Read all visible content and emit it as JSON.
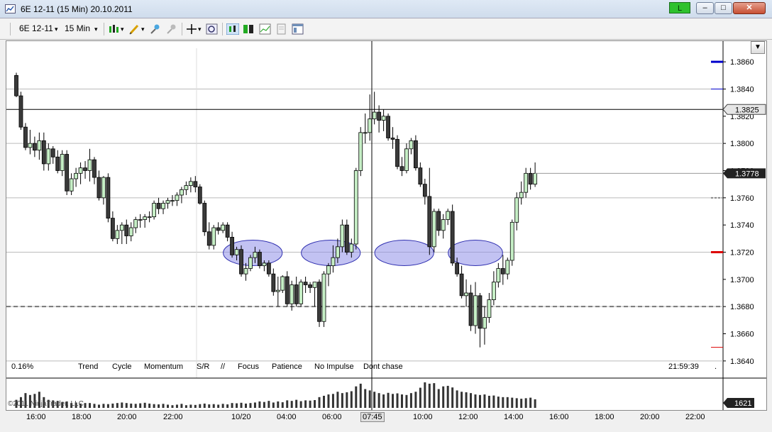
{
  "window": {
    "title": "6E 12-11 (15 Min)  20.10.2011",
    "connection_label": "L",
    "minimize": "–",
    "maximize": "□",
    "close": "✕"
  },
  "toolbar": {
    "instrument": "6E 12-11",
    "interval": "15 Min",
    "icons": [
      "bar-type-icon",
      "drawing-tools-icon",
      "indicator-icon",
      "strategy-icon",
      "crosshair-icon",
      "zoom-icon",
      "chart-trader-icon",
      "data-box-icon",
      "line-chart-icon",
      "properties-icon",
      "panel-icon"
    ]
  },
  "chart": {
    "price_ticks": [
      "1.3860",
      "1.3840",
      "1.3820",
      "1.3800",
      "1.3780",
      "1.3760",
      "1.3740",
      "1.3720",
      "1.3700",
      "1.3680",
      "1.3660",
      "1.3640"
    ],
    "current_price_label": "1.3778",
    "crosshair_price_label": "1.3825",
    "volume_label": "1621",
    "time_labels": [
      "16:00",
      "18:00",
      "20:00",
      "22:00",
      "10/20",
      "04:00",
      "06:00",
      "08:00",
      "10:00",
      "12:00",
      "14:00",
      "16:00",
      "18:00",
      "20:00",
      "22:00"
    ],
    "crosshair_time_label": "07:45",
    "info_percent": "0.16%",
    "info_time": "21:59:39",
    "info_dot": ".",
    "copyright": "©2011 NinjaTrader, LLC",
    "notes": [
      "Trend",
      "Cycle",
      "Momentum",
      "S/R",
      "//",
      "Focus",
      "Patience",
      "No Impulse",
      "Dont chase"
    ],
    "colors": {
      "up_fill": "#c6efc6",
      "down_fill": "#3a3a3a",
      "ellipse_fill": "#8f8fe8",
      "ellipse_stroke": "#3030b0",
      "blue_line": "#0000cc",
      "red_line": "#dd0000"
    }
  },
  "chart_data": {
    "type": "candlestick",
    "ylim": [
      1.363,
      1.387
    ],
    "candles": [
      [
        1.385,
        1.3852,
        1.3834,
        1.3835
      ],
      [
        1.3835,
        1.3838,
        1.381,
        1.3812
      ],
      [
        1.3812,
        1.3815,
        1.3795,
        1.3797
      ],
      [
        1.3797,
        1.381,
        1.3792,
        1.38
      ],
      [
        1.38,
        1.3805,
        1.379,
        1.3795
      ],
      [
        1.3795,
        1.3808,
        1.3788,
        1.3802
      ],
      [
        1.3802,
        1.3808,
        1.378,
        1.3785
      ],
      [
        1.3785,
        1.38,
        1.378,
        1.3796
      ],
      [
        1.3796,
        1.3798,
        1.3785,
        1.379
      ],
      [
        1.379,
        1.3795,
        1.3778,
        1.378
      ],
      [
        1.378,
        1.3795,
        1.3776,
        1.3792
      ],
      [
        1.3792,
        1.3795,
        1.3762,
        1.3765
      ],
      [
        1.3765,
        1.3778,
        1.3762,
        1.3774
      ],
      [
        1.3774,
        1.3782,
        1.3768,
        1.3778
      ],
      [
        1.3778,
        1.3786,
        1.377,
        1.3782
      ],
      [
        1.3782,
        1.3787,
        1.3774,
        1.378
      ],
      [
        1.378,
        1.3796,
        1.3772,
        1.3788
      ],
      [
        1.3788,
        1.379,
        1.377,
        1.3775
      ],
      [
        1.3775,
        1.378,
        1.3758,
        1.376
      ],
      [
        1.376,
        1.3776,
        1.3755,
        1.3775
      ],
      [
        1.3775,
        1.3778,
        1.3742,
        1.3745
      ],
      [
        1.3745,
        1.375,
        1.3728,
        1.373
      ],
      [
        1.373,
        1.374,
        1.3726,
        1.3736
      ],
      [
        1.3736,
        1.3742,
        1.3726,
        1.374
      ],
      [
        1.374,
        1.3744,
        1.3726,
        1.3732
      ],
      [
        1.3732,
        1.3742,
        1.3728,
        1.3738
      ],
      [
        1.3738,
        1.3746,
        1.3734,
        1.3744
      ],
      [
        1.3744,
        1.3748,
        1.3738,
        1.3744
      ],
      [
        1.3744,
        1.3748,
        1.3738,
        1.3746
      ],
      [
        1.3746,
        1.375,
        1.3742,
        1.3746
      ],
      [
        1.3746,
        1.3758,
        1.3744,
        1.3756
      ],
      [
        1.3756,
        1.376,
        1.3748,
        1.3752
      ],
      [
        1.3752,
        1.3758,
        1.3748,
        1.3756
      ],
      [
        1.3756,
        1.376,
        1.3752,
        1.3758
      ],
      [
        1.3758,
        1.3762,
        1.3754,
        1.3758
      ],
      [
        1.3758,
        1.3764,
        1.3754,
        1.3762
      ],
      [
        1.3762,
        1.3768,
        1.3756,
        1.3766
      ],
      [
        1.3766,
        1.3772,
        1.3762,
        1.3769
      ],
      [
        1.3769,
        1.3775,
        1.3764,
        1.3772
      ],
      [
        1.3772,
        1.3776,
        1.3764,
        1.3768
      ],
      [
        1.3768,
        1.377,
        1.3755,
        1.3756
      ],
      [
        1.3756,
        1.3758,
        1.3732,
        1.3735
      ],
      [
        1.3735,
        1.3742,
        1.3722,
        1.3725
      ],
      [
        1.3725,
        1.374,
        1.3722,
        1.3738
      ],
      [
        1.3738,
        1.3742,
        1.3733,
        1.3736
      ],
      [
        1.3736,
        1.3742,
        1.3734,
        1.374
      ],
      [
        1.374,
        1.3742,
        1.3728,
        1.3731
      ],
      [
        1.3731,
        1.3735,
        1.3716,
        1.3718
      ],
      [
        1.3718,
        1.3724,
        1.3714,
        1.3722
      ],
      [
        1.3722,
        1.3725,
        1.3702,
        1.3704
      ],
      [
        1.3704,
        1.3712,
        1.3699,
        1.3708
      ],
      [
        1.3708,
        1.3718,
        1.3706,
        1.3716
      ],
      [
        1.3716,
        1.3724,
        1.3712,
        1.372
      ],
      [
        1.372,
        1.3722,
        1.3708,
        1.371
      ],
      [
        1.371,
        1.3714,
        1.3706,
        1.3712
      ],
      [
        1.3712,
        1.3714,
        1.3702,
        1.3704
      ],
      [
        1.3704,
        1.3708,
        1.3688,
        1.3691
      ],
      [
        1.3691,
        1.3702,
        1.368,
        1.3692
      ],
      [
        1.3692,
        1.3703,
        1.369,
        1.3702
      ],
      [
        1.3702,
        1.3706,
        1.368,
        1.3682
      ],
      [
        1.3682,
        1.3699,
        1.3677,
        1.3696
      ],
      [
        1.3696,
        1.3702,
        1.368,
        1.3682
      ],
      [
        1.3682,
        1.37,
        1.368,
        1.3698
      ],
      [
        1.3698,
        1.3702,
        1.369,
        1.3696
      ],
      [
        1.3696,
        1.3698,
        1.369,
        1.3694
      ],
      [
        1.3694,
        1.3698,
        1.368,
        1.3698
      ],
      [
        1.3698,
        1.37,
        1.3665,
        1.3669
      ],
      [
        1.3669,
        1.3706,
        1.3665,
        1.3704
      ],
      [
        1.3704,
        1.3712,
        1.3695,
        1.371
      ],
      [
        1.371,
        1.3725,
        1.3705,
        1.3716
      ],
      [
        1.3716,
        1.373,
        1.3712,
        1.3724
      ],
      [
        1.3724,
        1.3744,
        1.372,
        1.374
      ],
      [
        1.374,
        1.3744,
        1.3718,
        1.372
      ],
      [
        1.372,
        1.373,
        1.3716,
        1.3726
      ],
      [
        1.3726,
        1.3782,
        1.3722,
        1.378
      ],
      [
        1.378,
        1.3812,
        1.3776,
        1.3808
      ],
      [
        1.3808,
        1.3822,
        1.38,
        1.3808
      ],
      [
        1.3808,
        1.3836,
        1.3802,
        1.3818
      ],
      [
        1.3818,
        1.3838,
        1.3814,
        1.3823
      ],
      [
        1.3823,
        1.3828,
        1.3808,
        1.3817
      ],
      [
        1.3817,
        1.3825,
        1.3809,
        1.382
      ],
      [
        1.382,
        1.3822,
        1.3802,
        1.3804
      ],
      [
        1.3804,
        1.3812,
        1.3796,
        1.3803
      ],
      [
        1.3803,
        1.3806,
        1.3781,
        1.3783
      ],
      [
        1.3783,
        1.379,
        1.3776,
        1.378
      ],
      [
        1.378,
        1.38,
        1.3778,
        1.3796
      ],
      [
        1.3796,
        1.3804,
        1.3792,
        1.3802
      ],
      [
        1.3802,
        1.3806,
        1.378,
        1.3782
      ],
      [
        1.3782,
        1.3786,
        1.3768,
        1.377
      ],
      [
        1.377,
        1.3774,
        1.3755,
        1.3761
      ],
      [
        1.3761,
        1.3782,
        1.3718,
        1.3724
      ],
      [
        1.3724,
        1.3752,
        1.372,
        1.375
      ],
      [
        1.375,
        1.3752,
        1.3732,
        1.3736
      ],
      [
        1.3736,
        1.3748,
        1.373,
        1.3744
      ],
      [
        1.3744,
        1.3752,
        1.374,
        1.375
      ],
      [
        1.375,
        1.3755,
        1.371,
        1.3712
      ],
      [
        1.3712,
        1.3716,
        1.3702,
        1.3704
      ],
      [
        1.3704,
        1.371,
        1.3686,
        1.3688
      ],
      [
        1.3688,
        1.37,
        1.368,
        1.369
      ],
      [
        1.369,
        1.3696,
        1.3662,
        1.3666
      ],
      [
        1.3666,
        1.3698,
        1.366,
        1.3688
      ],
      [
        1.3688,
        1.369,
        1.365,
        1.3664
      ],
      [
        1.3664,
        1.368,
        1.3652,
        1.3672
      ],
      [
        1.3672,
        1.369,
        1.3668,
        1.3685
      ],
      [
        1.3685,
        1.3706,
        1.3681,
        1.3698
      ],
      [
        1.3698,
        1.3712,
        1.3694,
        1.3708
      ],
      [
        1.3708,
        1.3718,
        1.3696,
        1.3704
      ],
      [
        1.3704,
        1.3716,
        1.37,
        1.3714
      ],
      [
        1.3714,
        1.3744,
        1.371,
        1.3742
      ],
      [
        1.3742,
        1.3764,
        1.3736,
        1.376
      ],
      [
        1.376,
        1.3772,
        1.3755,
        1.3764
      ],
      [
        1.3764,
        1.3782,
        1.376,
        1.3778
      ],
      [
        1.3778,
        1.3782,
        1.3766,
        1.377
      ],
      [
        1.377,
        1.3786,
        1.3768,
        1.3778
      ]
    ],
    "volumes": [
      30,
      40,
      55,
      48,
      52,
      60,
      40,
      30,
      28,
      26,
      22,
      24,
      18,
      20,
      16,
      18,
      18,
      15,
      12,
      15,
      14,
      16,
      18,
      20,
      18,
      16,
      15,
      17,
      19,
      16,
      14,
      13,
      15,
      12,
      10,
      12,
      15,
      10,
      12,
      11,
      14,
      16,
      13,
      14,
      12,
      15,
      13,
      18,
      17,
      19,
      16,
      18,
      20,
      24,
      22,
      26,
      20,
      24,
      21,
      28,
      26,
      30,
      25,
      28,
      27,
      29,
      40,
      45,
      50,
      52,
      60,
      55,
      58,
      62,
      80,
      90,
      70,
      65,
      60,
      55,
      50,
      56,
      52,
      54,
      50,
      48,
      55,
      60,
      75,
      95,
      90,
      92,
      70,
      80,
      82,
      76,
      65,
      60,
      58,
      55,
      50,
      48,
      50,
      45,
      46,
      42,
      40,
      40,
      38,
      36,
      34,
      36,
      38,
      32
    ],
    "ellipses_x_index": [
      [
        46,
        57
      ],
      [
        63,
        74
      ],
      [
        79,
        90
      ],
      [
        95,
        105
      ]
    ],
    "current_price": 1.3778,
    "crosshair_price": 1.3825,
    "reference_price": 1.368
  }
}
